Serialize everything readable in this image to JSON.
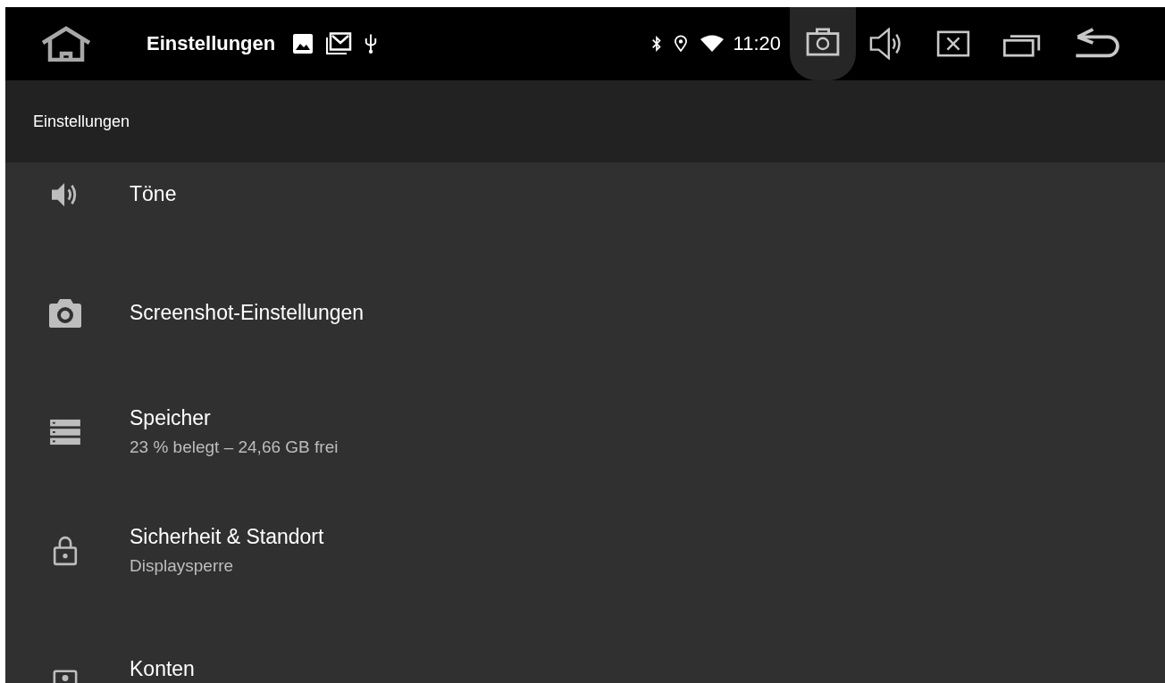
{
  "status_bar": {
    "title": "Einstellungen",
    "time": "11:20"
  },
  "header": {
    "title": "Einstellungen"
  },
  "settings": [
    {
      "title": "Töne"
    },
    {
      "title": "Screenshot-Einstellungen"
    },
    {
      "title": "Speicher",
      "subtitle": "23 % belegt – 24,66 GB frei"
    },
    {
      "title": "Sicherheit & Standort",
      "subtitle": "Displaysperre"
    },
    {
      "title": "Konten"
    }
  ]
}
